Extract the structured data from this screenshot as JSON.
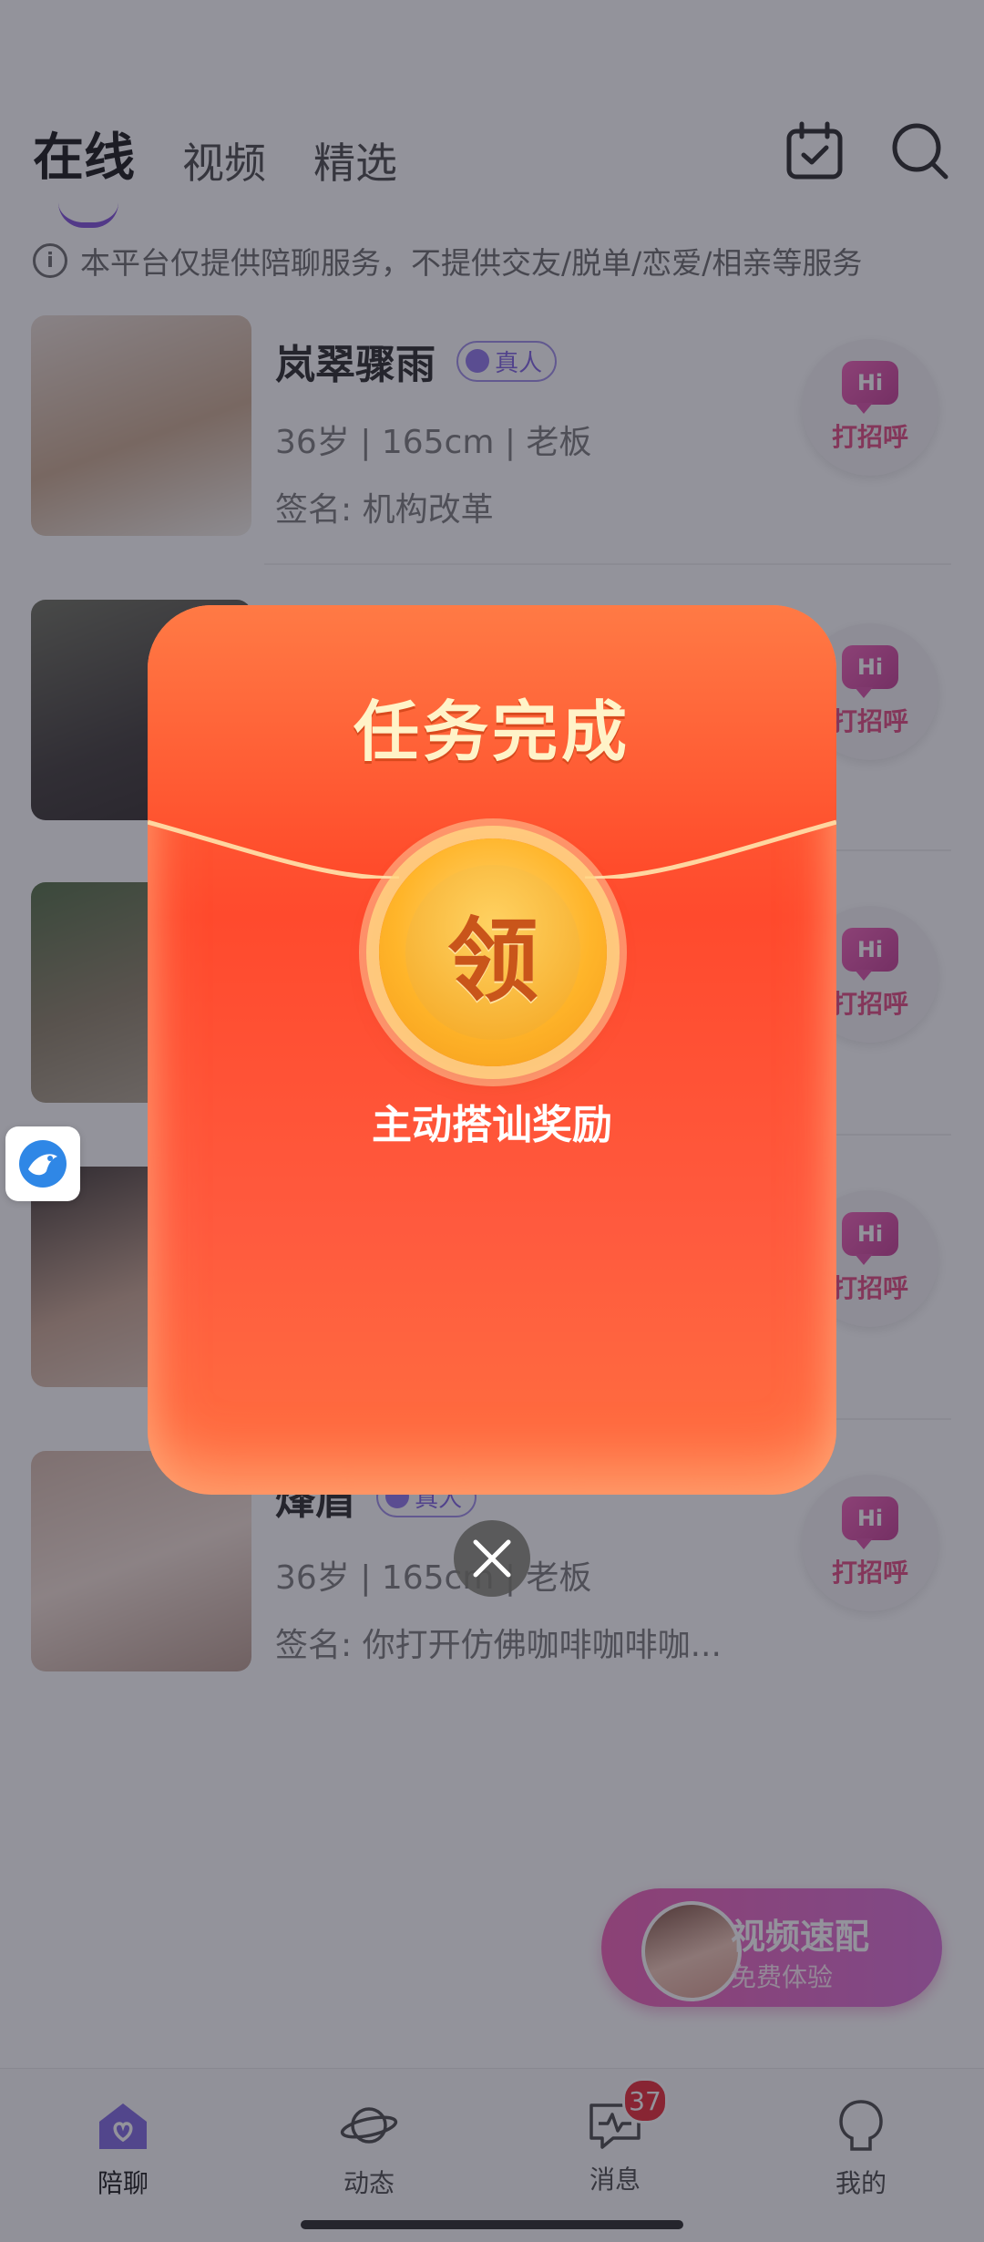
{
  "header": {
    "tabs": [
      {
        "label": "在线",
        "active": true
      },
      {
        "label": "视频",
        "active": false
      },
      {
        "label": "精选",
        "active": false
      }
    ],
    "icons": [
      "calendar-check-icon",
      "search-icon"
    ]
  },
  "notice": {
    "text": "本平台仅提供陪聊服务，不提供交友/脱单/恋爱/相亲等服务"
  },
  "users": [
    {
      "name": "岚翠骤雨",
      "badge": "真人",
      "meta": "36岁 | 165cm | 老板",
      "sign": "签名: 机构改革",
      "hi_label": "打招呼"
    },
    {
      "name": "",
      "badge": "",
      "meta": "",
      "sign": "",
      "hi_label": "打招呼"
    },
    {
      "name": "",
      "badge": "",
      "meta": "",
      "sign": "",
      "hi_label": "打招呼"
    },
    {
      "name": "",
      "badge": "",
      "meta": "",
      "sign": "",
      "hi_label": "打招呼"
    },
    {
      "name": "烽眉",
      "badge": "真人",
      "meta": "36岁 | 165cm | 老板",
      "sign": "签名: 你打开仿佛咖啡咖啡咖...",
      "hi_label": "打招呼"
    }
  ],
  "hi_bubble": "Hi",
  "video_match": {
    "title": "视频速配",
    "subtitle": "免费体验"
  },
  "bottom_nav": [
    {
      "label": "陪聊",
      "icon": "home-heart-icon",
      "active": true
    },
    {
      "label": "动态",
      "icon": "planet-icon",
      "active": false
    },
    {
      "label": "消息",
      "icon": "chat-pulse-icon",
      "active": false,
      "badge": "37"
    },
    {
      "label": "我的",
      "icon": "profile-icon",
      "active": false
    }
  ],
  "modal": {
    "title": "任务完成",
    "coin_label": "领",
    "subtitle": "主动搭讪奖励"
  },
  "colors": {
    "accent": "#7d4ad8",
    "hi_pink": "#e0457d",
    "packet_red": "#ff4a2d",
    "coin_gold": "#ffb52a",
    "badge_red": "#e8232e"
  }
}
